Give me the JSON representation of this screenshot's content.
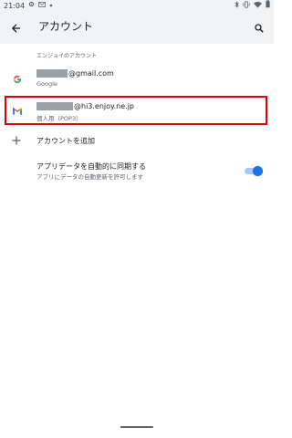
{
  "status_bar": {
    "time": "21:04",
    "icons": [
      "settings-icon",
      "gmail-icon",
      "dot-icon",
      "bluetooth-icon",
      "vibrate-icon",
      "wifi-icon",
      "battery-icon"
    ]
  },
  "toolbar": {
    "title": "アカウント",
    "back_icon": "arrow-back-icon",
    "search_icon": "search-icon"
  },
  "section_header": "エンジョイのアカウント",
  "accounts": [
    {
      "email_suffix": "@gmail.com",
      "type_label": "Google",
      "icon": "google-icon"
    },
    {
      "email_suffix": "@hi3.enjoy.ne.jp",
      "type_label": "個人用（POP3）",
      "icon": "gmail-icon",
      "highlighted": true
    }
  ],
  "add_account": {
    "label": "アカウントを追加",
    "icon": "plus-icon"
  },
  "auto_sync": {
    "title": "アプリデータを自動的に同期する",
    "description": "アプリにデータの自動更新を許可します",
    "enabled": true
  },
  "colors": {
    "accent": "#1a73e8",
    "highlight_border": "#e00000",
    "toolbar_bg": "#f1f3f4"
  }
}
